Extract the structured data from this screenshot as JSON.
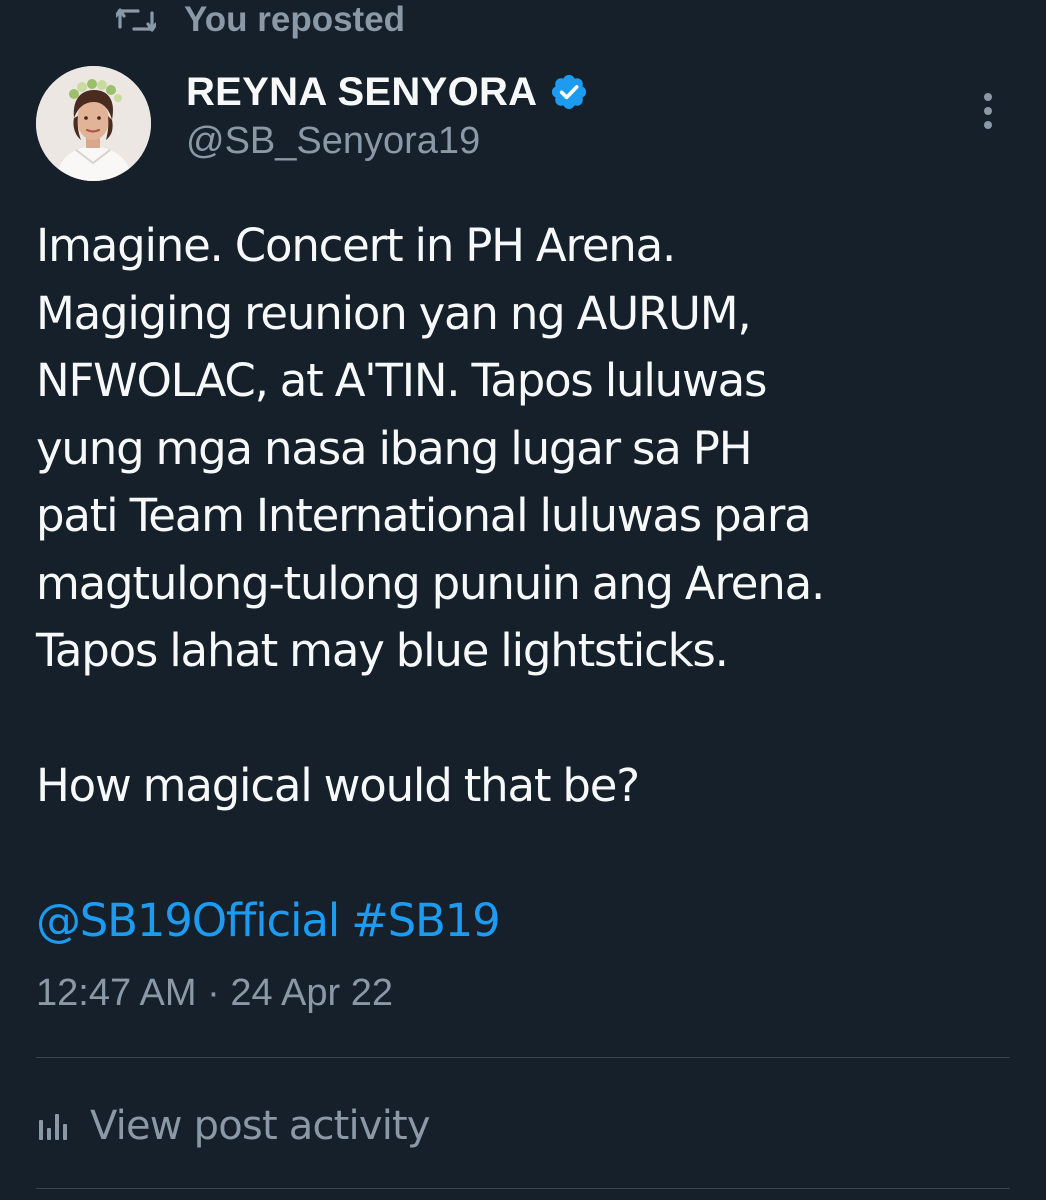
{
  "repost_banner": {
    "label": "You reposted",
    "icon": "repost-icon"
  },
  "author": {
    "display_name": "REYNA SENYORA",
    "handle": "@SB_Senyora19",
    "verified_icon": "verified-badge-icon",
    "verified_color": "#1d9bf0"
  },
  "tweet": {
    "lines": [
      "Imagine. Concert in PH Arena.",
      "Magiging reunion yan ng AURUM,",
      "NFWOLAC, at A'TIN. Tapos luluwas",
      "yung mga nasa ibang lugar sa PH",
      "pati Team International luluwas para",
      "magtulong-tulong punuin ang Arena.",
      "Tapos lahat may blue lightsticks.",
      "How magical would that be?"
    ],
    "mention": "@SB19Official",
    "hashtag": "#SB19"
  },
  "timestamp": "12:47 AM · 24 Apr 22",
  "activity": {
    "label": "View post activity",
    "icon": "analytics-icon"
  },
  "colors": {
    "background": "#15202b",
    "text": "#f7f9f9",
    "secondary": "#8b98a5",
    "link": "#1d9bf0",
    "divider": "#38444d"
  }
}
